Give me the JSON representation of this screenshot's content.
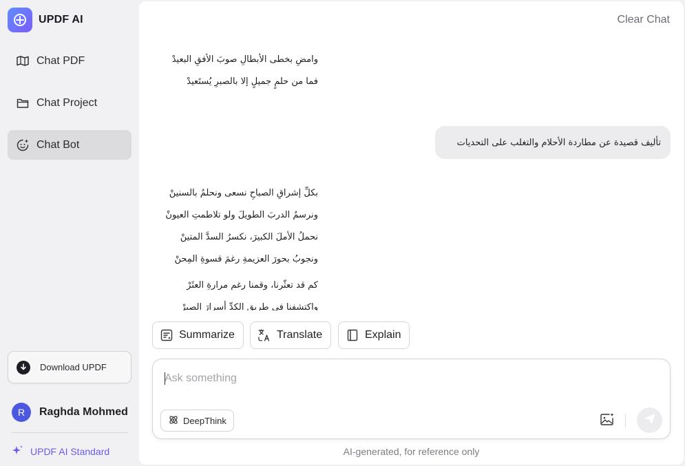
{
  "app": {
    "name": "UPDF AI",
    "logo_icon": "updf-ai-logo-icon"
  },
  "sidebar": {
    "items": [
      {
        "label": "Chat PDF",
        "icon": "book-open-icon",
        "active": false
      },
      {
        "label": "Chat Project",
        "icon": "folder-icon",
        "active": false
      },
      {
        "label": "Chat Bot",
        "icon": "bot-face-icon",
        "active": true
      }
    ],
    "download_label": "Download UPDF",
    "user": {
      "initial": "R",
      "name": "Raghda Mohmed"
    },
    "plan_label": "UPDF AI Standard"
  },
  "header": {
    "clear_chat": "Clear Chat"
  },
  "chat": {
    "ai_block_1": [
      "وامضِ بخطى الأبطالِ صوبَ الأفقِ البعيدْ",
      "فما من حلمٍ جميلٍ إلا بالصبرِ يُستَعيدْ"
    ],
    "user_message": "تأليف قصيدة عن مطاردة الأحلام والتغلب على التحديات",
    "ai_block_2": [
      "بكلِّ إشراقِ الصباحِ نسعى ونحلمُ بالسنينْ",
      "ونرسمُ الدربَ الطويلَ ولو تلاطمتِ العيونْ",
      "نحملُ الأملَ الكبيرَ، نكسرُ السدَّ المتينْ",
      "ونجوبُ بحورَ العزيمةِ رغمَ قسوةِ المِحنْ"
    ],
    "ai_block_3": [
      "كم قد تعثّرنا، وقمنا رغم مرارةِ العثَرْ",
      "واكتشفنا في طريقِ الكدِّ أسرارَ الصبرْ"
    ]
  },
  "quick_actions": [
    {
      "label": "Summarize",
      "icon": "summarize-icon"
    },
    {
      "label": "Translate",
      "icon": "translate-icon"
    },
    {
      "label": "Explain",
      "icon": "book-icon"
    }
  ],
  "composer": {
    "placeholder": "Ask something",
    "value": "",
    "deepthink_label": "DeepThink"
  },
  "footer": {
    "disclaimer": "AI-generated, for reference only"
  },
  "colors": {
    "accent": "#6b5cf0",
    "avatar": "#4d58e0",
    "active_nav": "#dcdcdf"
  }
}
